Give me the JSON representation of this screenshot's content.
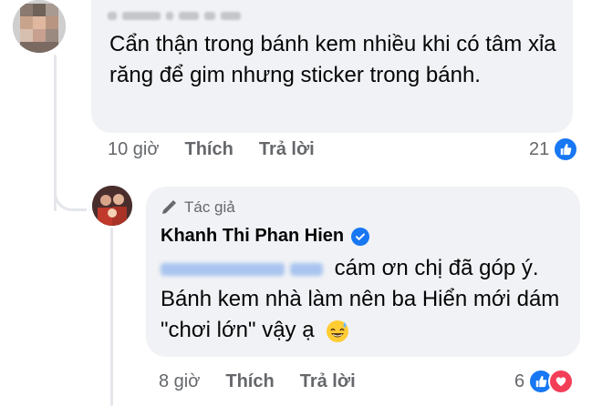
{
  "comment": {
    "text": "Cẩn thận trong bánh kem nhiều khi có tâm xỉa răng để gim nhưng sticker trong bánh.",
    "time": "10 giờ",
    "like_label": "Thích",
    "reply_label": "Trả lời",
    "reaction_count": "21"
  },
  "reply": {
    "author_badge": "Tác giả",
    "author_name": "Khanh Thi Phan Hien",
    "text_after_mention": "cám ơn chị đã góp ý. Bánh kem nhà làm nên ba Hiển mới dám \"chơi lớn\" vậy ạ",
    "time": "8 giờ",
    "like_label": "Thích",
    "reply_label": "Trả lời",
    "reaction_count": "6"
  },
  "colors": {
    "bubble": "#f0f2f5",
    "meta_text": "#65676b",
    "like_blue": "#1877f2",
    "love_red": "#f33e58"
  },
  "icons": [
    "like-icon",
    "love-icon",
    "pencil-icon",
    "verified-badge-icon",
    "grinning-sweat-emoji"
  ]
}
